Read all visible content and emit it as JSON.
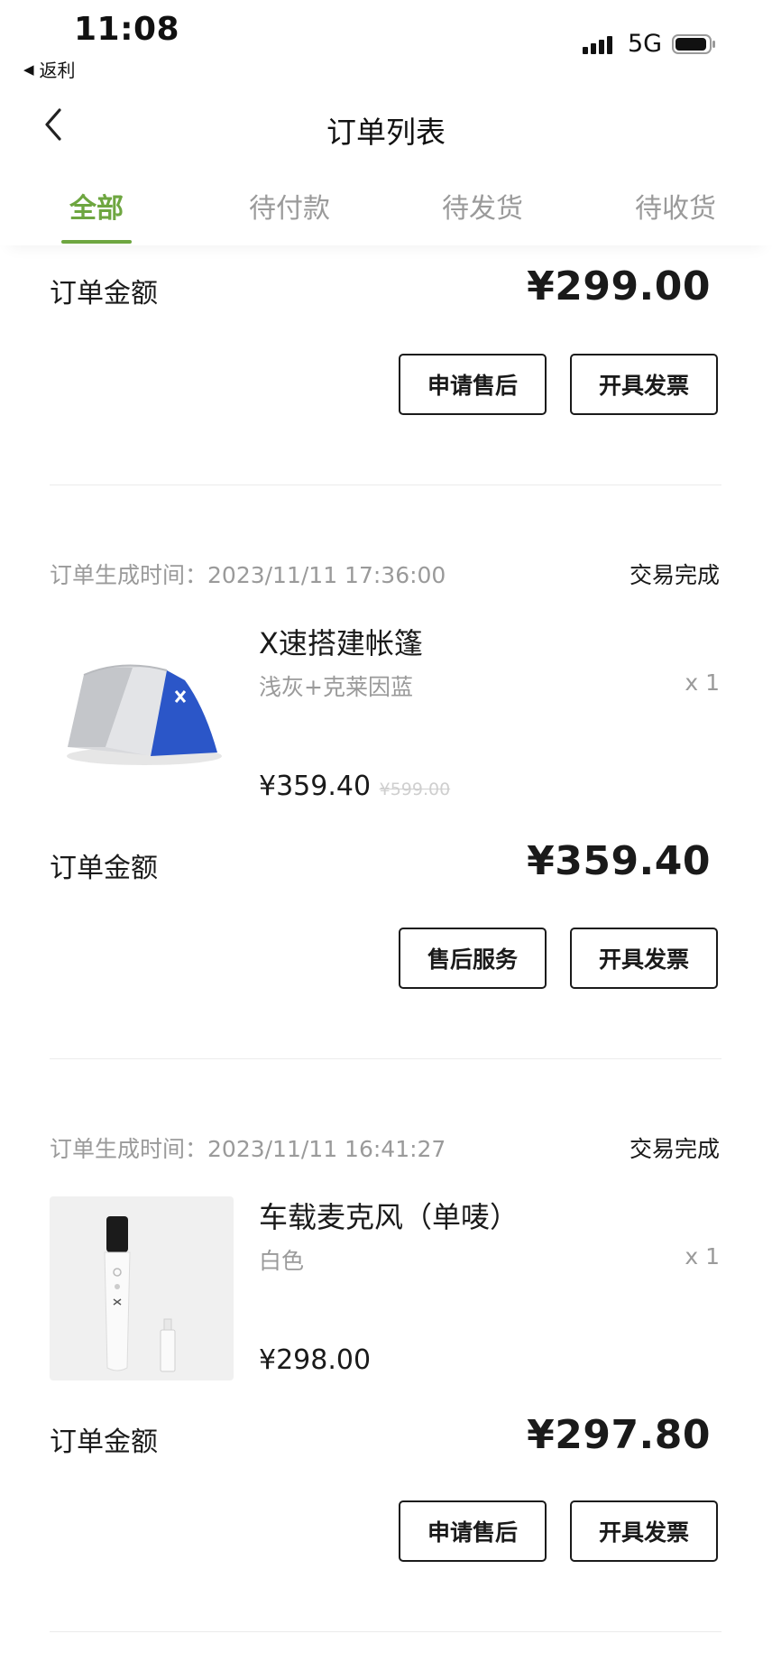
{
  "status_bar": {
    "time": "11:08",
    "back_app": "返利",
    "network": "5G"
  },
  "nav": {
    "title": "订单列表"
  },
  "tabs": [
    {
      "label": "全部",
      "active": true
    },
    {
      "label": "待付款",
      "active": false
    },
    {
      "label": "待发货",
      "active": false
    },
    {
      "label": "待收货",
      "active": false
    }
  ],
  "orders": [
    {
      "total_label": "订单金额",
      "total": "¥299.00",
      "buttons": [
        "申请售后",
        "开具发票"
      ]
    },
    {
      "created_label": "订单生成时间：",
      "created_at": "2023/11/11 17:36:00",
      "status": "交易完成",
      "product": {
        "name": "X速搭建帐篷",
        "spec": "浅灰+克莱因蓝",
        "qty": "x 1",
        "price": "¥359.40",
        "original_price": "¥599.00",
        "image": "tent-image"
      },
      "total_label": "订单金额",
      "total": "¥359.40",
      "buttons": [
        "售后服务",
        "开具发票"
      ]
    },
    {
      "created_label": "订单生成时间：",
      "created_at": "2023/11/11 16:41:27",
      "status": "交易完成",
      "product": {
        "name": "车载麦克风（单唛）",
        "spec": "白色",
        "qty": "x 1",
        "price": "¥298.00",
        "image": "microphone-image"
      },
      "total_label": "订单金额",
      "total": "¥297.80",
      "buttons": [
        "申请售后",
        "开具发票"
      ]
    }
  ],
  "colors": {
    "accent": "#6ea640",
    "text": "#1a1a1a",
    "muted": "#9a9a9a"
  }
}
